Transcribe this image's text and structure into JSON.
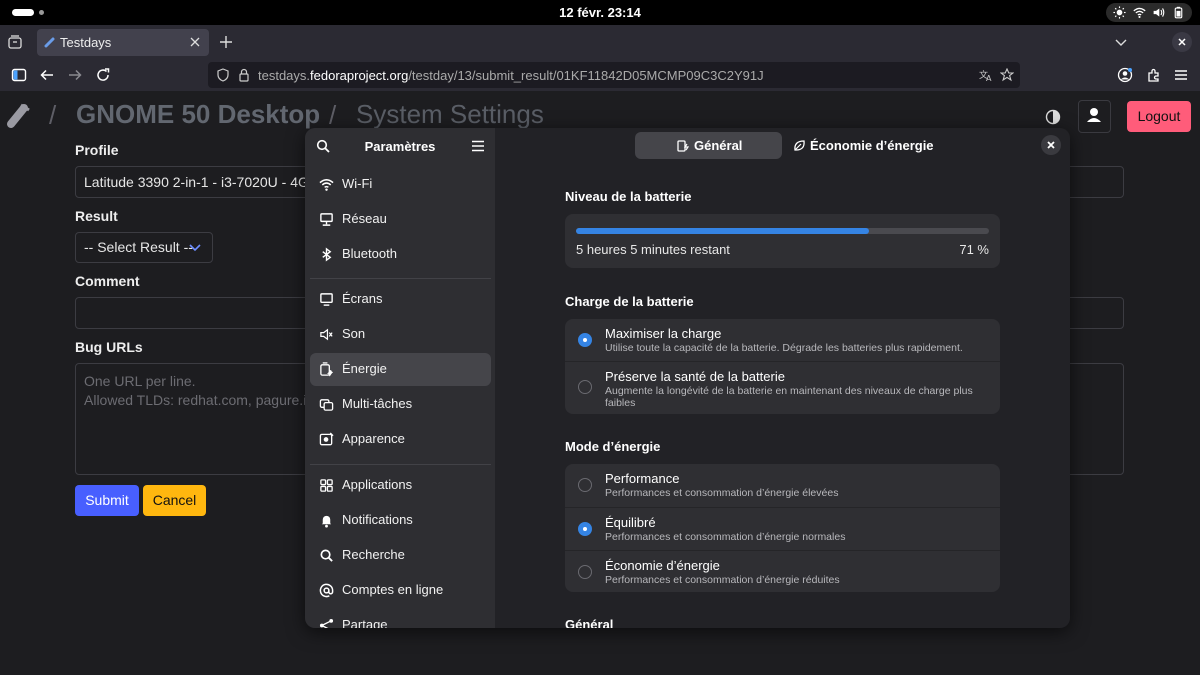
{
  "system_bar": {
    "clock": "12 févr.  23:14"
  },
  "browser": {
    "tab_title": "Testdays",
    "url_prefix": "testdays.",
    "url_host": "fedoraproject.org",
    "url_path": "/testday/13/submit_result/01KF11842D05MCMP09C3C2Y91J"
  },
  "page": {
    "crumb_app": "GNOME 50 Desktop",
    "crumb_sep": "/",
    "crumb_section": "System Settings",
    "logout": "Logout",
    "profile_label": "Profile",
    "profile_value": "Latitude 3390 2-in-1 - i3-7020U - 4GB R",
    "result_label": "Result",
    "result_value": "-- Select Result --",
    "comment_label": "Comment",
    "bugs_label": "Bug URLs",
    "bugs_placeholder_1": "One URL per line.",
    "bugs_placeholder_2": "Allowed TLDs: redhat.com, pagure.io, gi",
    "submit": "Submit",
    "cancel": "Cancel"
  },
  "settings": {
    "sidebar_title": "Paramètres",
    "sidebar_items": [
      {
        "label": "Wi-Fi",
        "icon": "wifi-icon"
      },
      {
        "label": "Réseau",
        "icon": "network-icon"
      },
      {
        "label": "Bluetooth",
        "icon": "bluetooth-icon"
      },
      {
        "label": "Écrans",
        "icon": "display-icon"
      },
      {
        "label": "Son",
        "icon": "sound-icon"
      },
      {
        "label": "Énergie",
        "icon": "power-icon",
        "active": true
      },
      {
        "label": "Multi-tâches",
        "icon": "multitasking-icon"
      },
      {
        "label": "Apparence",
        "icon": "appearance-icon"
      },
      {
        "label": "Applications",
        "icon": "apps-icon"
      },
      {
        "label": "Notifications",
        "icon": "bell-icon"
      },
      {
        "label": "Recherche",
        "icon": "search-icon"
      },
      {
        "label": "Comptes en ligne",
        "icon": "at-icon"
      },
      {
        "label": "Partage",
        "icon": "share-icon"
      }
    ],
    "tab_general": "Général",
    "tab_eco": "Économie d’énergie",
    "battery_level_title": "Niveau de la batterie",
    "battery_fraction": 0.71,
    "battery_remaining": "5 heures 5 minutes restant",
    "battery_percent": "71 %",
    "charge_title": "Charge de la batterie",
    "charge_options": [
      {
        "title": "Maximiser la charge",
        "subtitle": "Utilise toute la capacité de la batterie. Dégrade les batteries plus rapidement.",
        "selected": true
      },
      {
        "title": "Préserve la santé de la batterie",
        "subtitle": "Augmente la longévité de la batterie en maintenant des niveaux de charge plus faibles",
        "selected": false
      }
    ],
    "mode_title": "Mode d’énergie",
    "mode_options": [
      {
        "title": "Performance",
        "subtitle": "Performances et consommation d’énergie élevées",
        "selected": false
      },
      {
        "title": "Équilibré",
        "subtitle": "Performances et consommation d’énergie normales",
        "selected": true
      },
      {
        "title": "Économie d’énergie",
        "subtitle": "Performances et consommation d’énergie réduites",
        "selected": false
      }
    ],
    "general_title": "Général"
  },
  "colors": {
    "accent": "#3584e4",
    "logout": "#ff5c7a",
    "submit": "#485fff",
    "cancel": "#ffb70f"
  }
}
